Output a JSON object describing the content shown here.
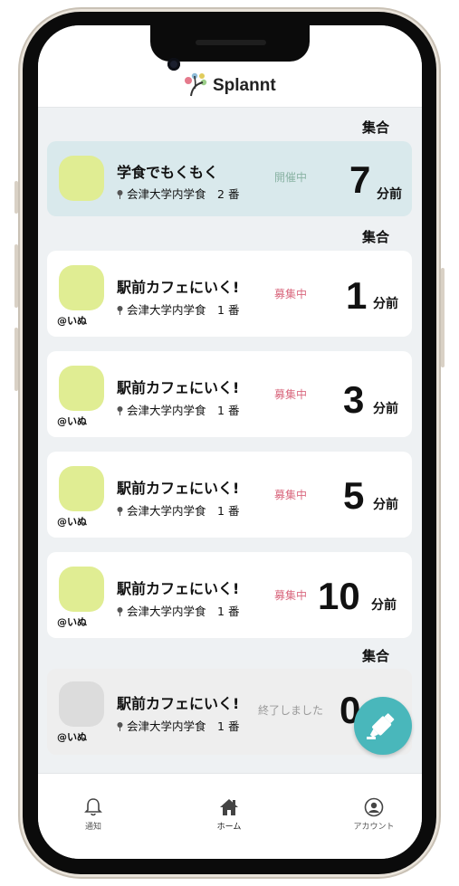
{
  "app": {
    "title": "Splannt"
  },
  "sections": [
    "集合",
    "集合",
    "集合"
  ],
  "events": [
    {
      "title": "学食でもくもく",
      "location": "会津大学内学食",
      "slot": "2 番",
      "status": "開催中",
      "status_kind": "open",
      "minutes": "7",
      "unit": "分前",
      "handle": ""
    },
    {
      "title": "駅前カフェにいく!",
      "location": "会津大学内学食",
      "slot": "1 番",
      "status": "募集中",
      "status_kind": "recruit",
      "minutes": "1",
      "unit": "分前",
      "handle": "@いぬ"
    },
    {
      "title": "駅前カフェにいく!",
      "location": "会津大学内学食",
      "slot": "1 番",
      "status": "募集中",
      "status_kind": "recruit",
      "minutes": "3",
      "unit": "分前",
      "handle": "@いぬ"
    },
    {
      "title": "駅前カフェにいく!",
      "location": "会津大学内学食",
      "slot": "1 番",
      "status": "募集中",
      "status_kind": "recruit",
      "minutes": "5",
      "unit": "分前",
      "handle": "@いぬ"
    },
    {
      "title": "駅前カフェにいく!",
      "location": "会津大学内学食",
      "slot": "1 番",
      "status": "募集中",
      "status_kind": "recruit",
      "minutes": "10",
      "unit": "分前",
      "handle": "@いぬ"
    },
    {
      "title": "駅前カフェにいく!",
      "location": "会津大学内学食",
      "slot": "1 番",
      "status": "終了しました",
      "status_kind": "ended",
      "minutes": "0",
      "unit": "",
      "handle": "@いぬ"
    }
  ],
  "tabs": [
    {
      "label": "通知",
      "icon": "bell-icon"
    },
    {
      "label": "ホーム",
      "icon": "home-icon"
    },
    {
      "label": "アカウント",
      "icon": "account-icon"
    }
  ],
  "colors": {
    "accent": "#49b7bb",
    "avatar": "#e0ed93",
    "recruit": "#d9687e",
    "open": "#8ab3a4",
    "active_card": "#d9e9ec"
  }
}
